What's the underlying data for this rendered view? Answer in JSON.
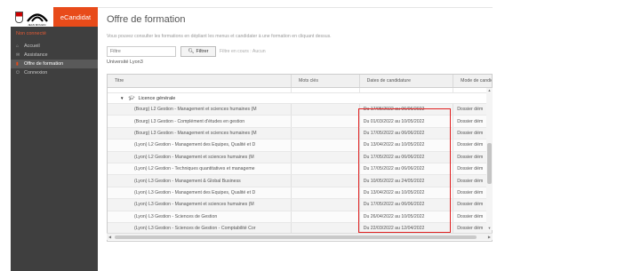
{
  "app": {
    "name": "eCandidat",
    "logo_text": "JEAN MOULIN"
  },
  "sidebar": {
    "user_line": "Non connecté",
    "items": [
      {
        "label": "Accueil",
        "icon": "home-icon"
      },
      {
        "label": "Assistance",
        "icon": "support-icon"
      },
      {
        "label": "Offre de formation",
        "icon": "bookmark-icon",
        "active": true
      },
      {
        "label": "Connexion",
        "icon": "power-icon"
      }
    ]
  },
  "main": {
    "title": "Offre de formation",
    "subtitle": "Vous pouvez consulter les formations en dépliant les menus et candidater à une formation en cliquant dessus.",
    "filter_placeholder": "Filtre",
    "filter_button": "Filtrer",
    "filter_status": "Filtre en cours : Aucun",
    "university": "Université Lyon3"
  },
  "table": {
    "columns": [
      "Titre",
      "Mots clés",
      "Dates de candidature",
      "Mode de candidature"
    ],
    "group": "Licence générale",
    "rows": [
      {
        "title": "(Bourg) L2 Gestion - Management et sciences humaines (M",
        "keywords": "",
        "dates": "Du 17/05/2022 au 06/06/2022",
        "mode": "Dossier dém"
      },
      {
        "title": "(Bourg) L3 Gestion - Complément d'études en gestion",
        "keywords": "",
        "dates": "Du 01/03/2022 au 10/05/2022",
        "mode": "Dossier dém"
      },
      {
        "title": "(Bourg) L3 Gestion - Management et sciences humaines (M",
        "keywords": "",
        "dates": "Du 17/05/2022 au 06/06/2022",
        "mode": "Dossier dém"
      },
      {
        "title": "(Lyon) L2 Gestion - Management des Equipes, Qualité et D",
        "keywords": "",
        "dates": "Du 13/04/2022 au 10/05/2022",
        "mode": "Dossier dém"
      },
      {
        "title": "(Lyon) L2 Gestion - Management et sciences humaines (M",
        "keywords": "",
        "dates": "Du 17/05/2022 au 06/06/2022",
        "mode": "Dossier dém"
      },
      {
        "title": "(Lyon) L2 Gestion - Techniques quantitatives et manageme",
        "keywords": "",
        "dates": "Du 17/05/2022 au 06/06/2022",
        "mode": "Dossier dém"
      },
      {
        "title": "(Lyon) L3 Gestion - Management & Global Business",
        "keywords": "",
        "dates": "Du 10/05/2022 au 24/05/2022",
        "mode": "Dossier dém"
      },
      {
        "title": "(Lyon) L3 Gestion - Management des Equipes, Qualité et D",
        "keywords": "",
        "dates": "Du 13/04/2022 au 10/05/2022",
        "mode": "Dossier dém"
      },
      {
        "title": "(Lyon) L3 Gestion - Management et sciences humaines (M",
        "keywords": "",
        "dates": "Du 17/05/2022 au 06/06/2022",
        "mode": "Dossier dém"
      },
      {
        "title": "(Lyon) L3 Gestion - Sciences de Gestion",
        "keywords": "",
        "dates": "Du 26/04/2022 au 10/05/2022",
        "mode": "Dossier dém"
      },
      {
        "title": "(Lyon) L3 Gestion - Sciences de Gestion - Comptabilité Cor",
        "keywords": "",
        "dates": "Du 22/03/2022 au 12/04/2022",
        "mode": "Dossier dém"
      }
    ]
  },
  "colors": {
    "accent": "#e84b1a",
    "sidebar_bg": "#3f3f3f",
    "highlight": "#e02020"
  }
}
